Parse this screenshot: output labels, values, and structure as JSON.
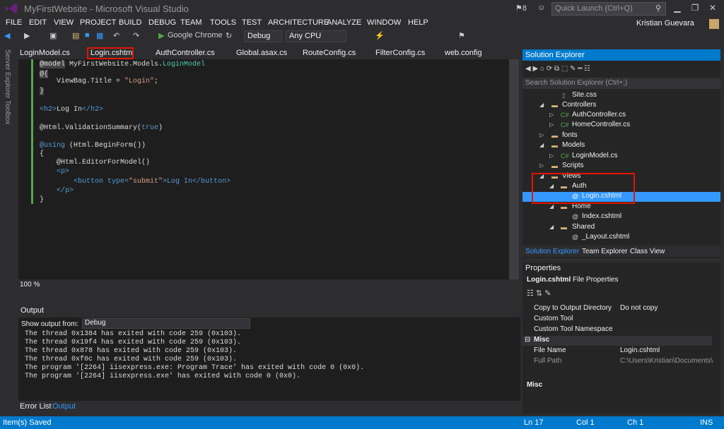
{
  "window": {
    "title": "MyFirstWebsite - Microsoft Visual Studio",
    "notif": "8",
    "quick_launch": "Quick Launch (Ctrl+Q)",
    "user": "Kristian Guevara",
    "controls": [
      "▁",
      "❐",
      "✕"
    ]
  },
  "menu": [
    "FILE",
    "EDIT",
    "VIEW",
    "PROJECT",
    "BUILD",
    "DEBUG",
    "TEAM",
    "TOOLS",
    "TEST",
    "ARCHITECTURE",
    "ANALYZE",
    "WINDOW",
    "HELP"
  ],
  "toolbar": {
    "browser": "Google Chrome",
    "config": "Debug",
    "platform": "Any CPU"
  },
  "sidebar": {
    "server": "Server Explorer",
    "toolbox": "Toolbox"
  },
  "tabs": [
    "LoginModel.cs",
    "Login.cshtml",
    "AuthController.cs",
    "Global.asax.cs",
    "RouteConfig.cs",
    "FilterConfig.cs",
    "web.config"
  ],
  "code": [
    {
      "a": "@model",
      "b": " MyFirstWebsite.Models.",
      "c": "LoginModel",
      "d": ""
    },
    {
      "a": "@{",
      "b": "",
      "c": "",
      "d": ""
    },
    {
      "a": "    ViewBag.Title = ",
      "b": "\"Login\"",
      "c": ";",
      "d": ""
    },
    {
      "a": "}",
      "b": "",
      "c": "",
      "d": ""
    },
    {
      "a": "<h2>",
      "b": "Log In",
      "c": "</h2>",
      "d": ""
    },
    {
      "a": "@Html.ValidationSummary(",
      "b": "true",
      "c": ")",
      "d": ""
    },
    {
      "a": "@using",
      "b": " (Html.BeginForm())",
      "c": "",
      "d": ""
    },
    {
      "a": "{",
      "b": "",
      "c": "",
      "d": ""
    },
    {
      "a": "    @Html.EditorForModel()",
      "b": "",
      "c": "",
      "d": ""
    },
    {
      "a": "    <p>",
      "b": "",
      "c": "",
      "d": ""
    },
    {
      "a": "        <button type=",
      "b": "\"submit\"",
      "c": ">Log In</button>",
      "d": ""
    },
    {
      "a": "    </p>",
      "b": "",
      "c": "",
      "d": ""
    },
    {
      "a": "}",
      "b": "",
      "c": "",
      "d": ""
    }
  ],
  "zoom": "100 %",
  "output": {
    "title": "Output",
    "show_from": "Show output from:",
    "source": "Debug",
    "lines": [
      "The thread 0x1384 has exited with code 259 (0x103).",
      "The thread 0x19f4 has exited with code 259 (0x103).",
      "The thread 0x878 has exited with code 259 (0x103).",
      "The thread 0xf0c has exited with code 259 (0x103).",
      "The program '[2264] iisexpress.exe: Program Trace' has exited with code 0 (0x0).",
      "The program '[2264] iisexpress.exe' has exited with code 0 (0x0)."
    ],
    "tabs": [
      "Error List",
      "Output"
    ]
  },
  "solution_explorer": {
    "title": "Solution Explorer",
    "search": "Search Solution Explorer (Ctrl+;)",
    "items": [
      "Site.css",
      "Controllers",
      "AuthController.cs",
      "HomeController.cs",
      "fonts",
      "Models",
      "LoginModel.cs",
      "Scripts",
      "Views",
      "Auth",
      "Login.cshtml",
      "Home",
      "Index.cshtml",
      "Shared",
      "_Layout.cshtml"
    ],
    "tabs": [
      "Solution Explorer",
      "Team Explorer",
      "Class View"
    ]
  },
  "properties": {
    "title": "Properties",
    "object": "Login.cshtml",
    "object_type": "File Properties",
    "rows": [
      {
        "k": "Copy to Output Directory",
        "v": "Do not copy"
      },
      {
        "k": "Custom Tool",
        "v": ""
      },
      {
        "k": "Custom Tool Namespace",
        "v": ""
      },
      {
        "k": "Misc",
        "v": ""
      },
      {
        "k": "File Name",
        "v": "Login.cshtml"
      },
      {
        "k": "Full Path",
        "v": "C:\\Users\\Kristian\\Documents\\"
      }
    ],
    "desc": "Misc"
  },
  "status": {
    "left": "Item(s) Saved",
    "ln": "Ln 17",
    "col": "Col 1",
    "ch": "Ch 1",
    "mode": "INS"
  }
}
